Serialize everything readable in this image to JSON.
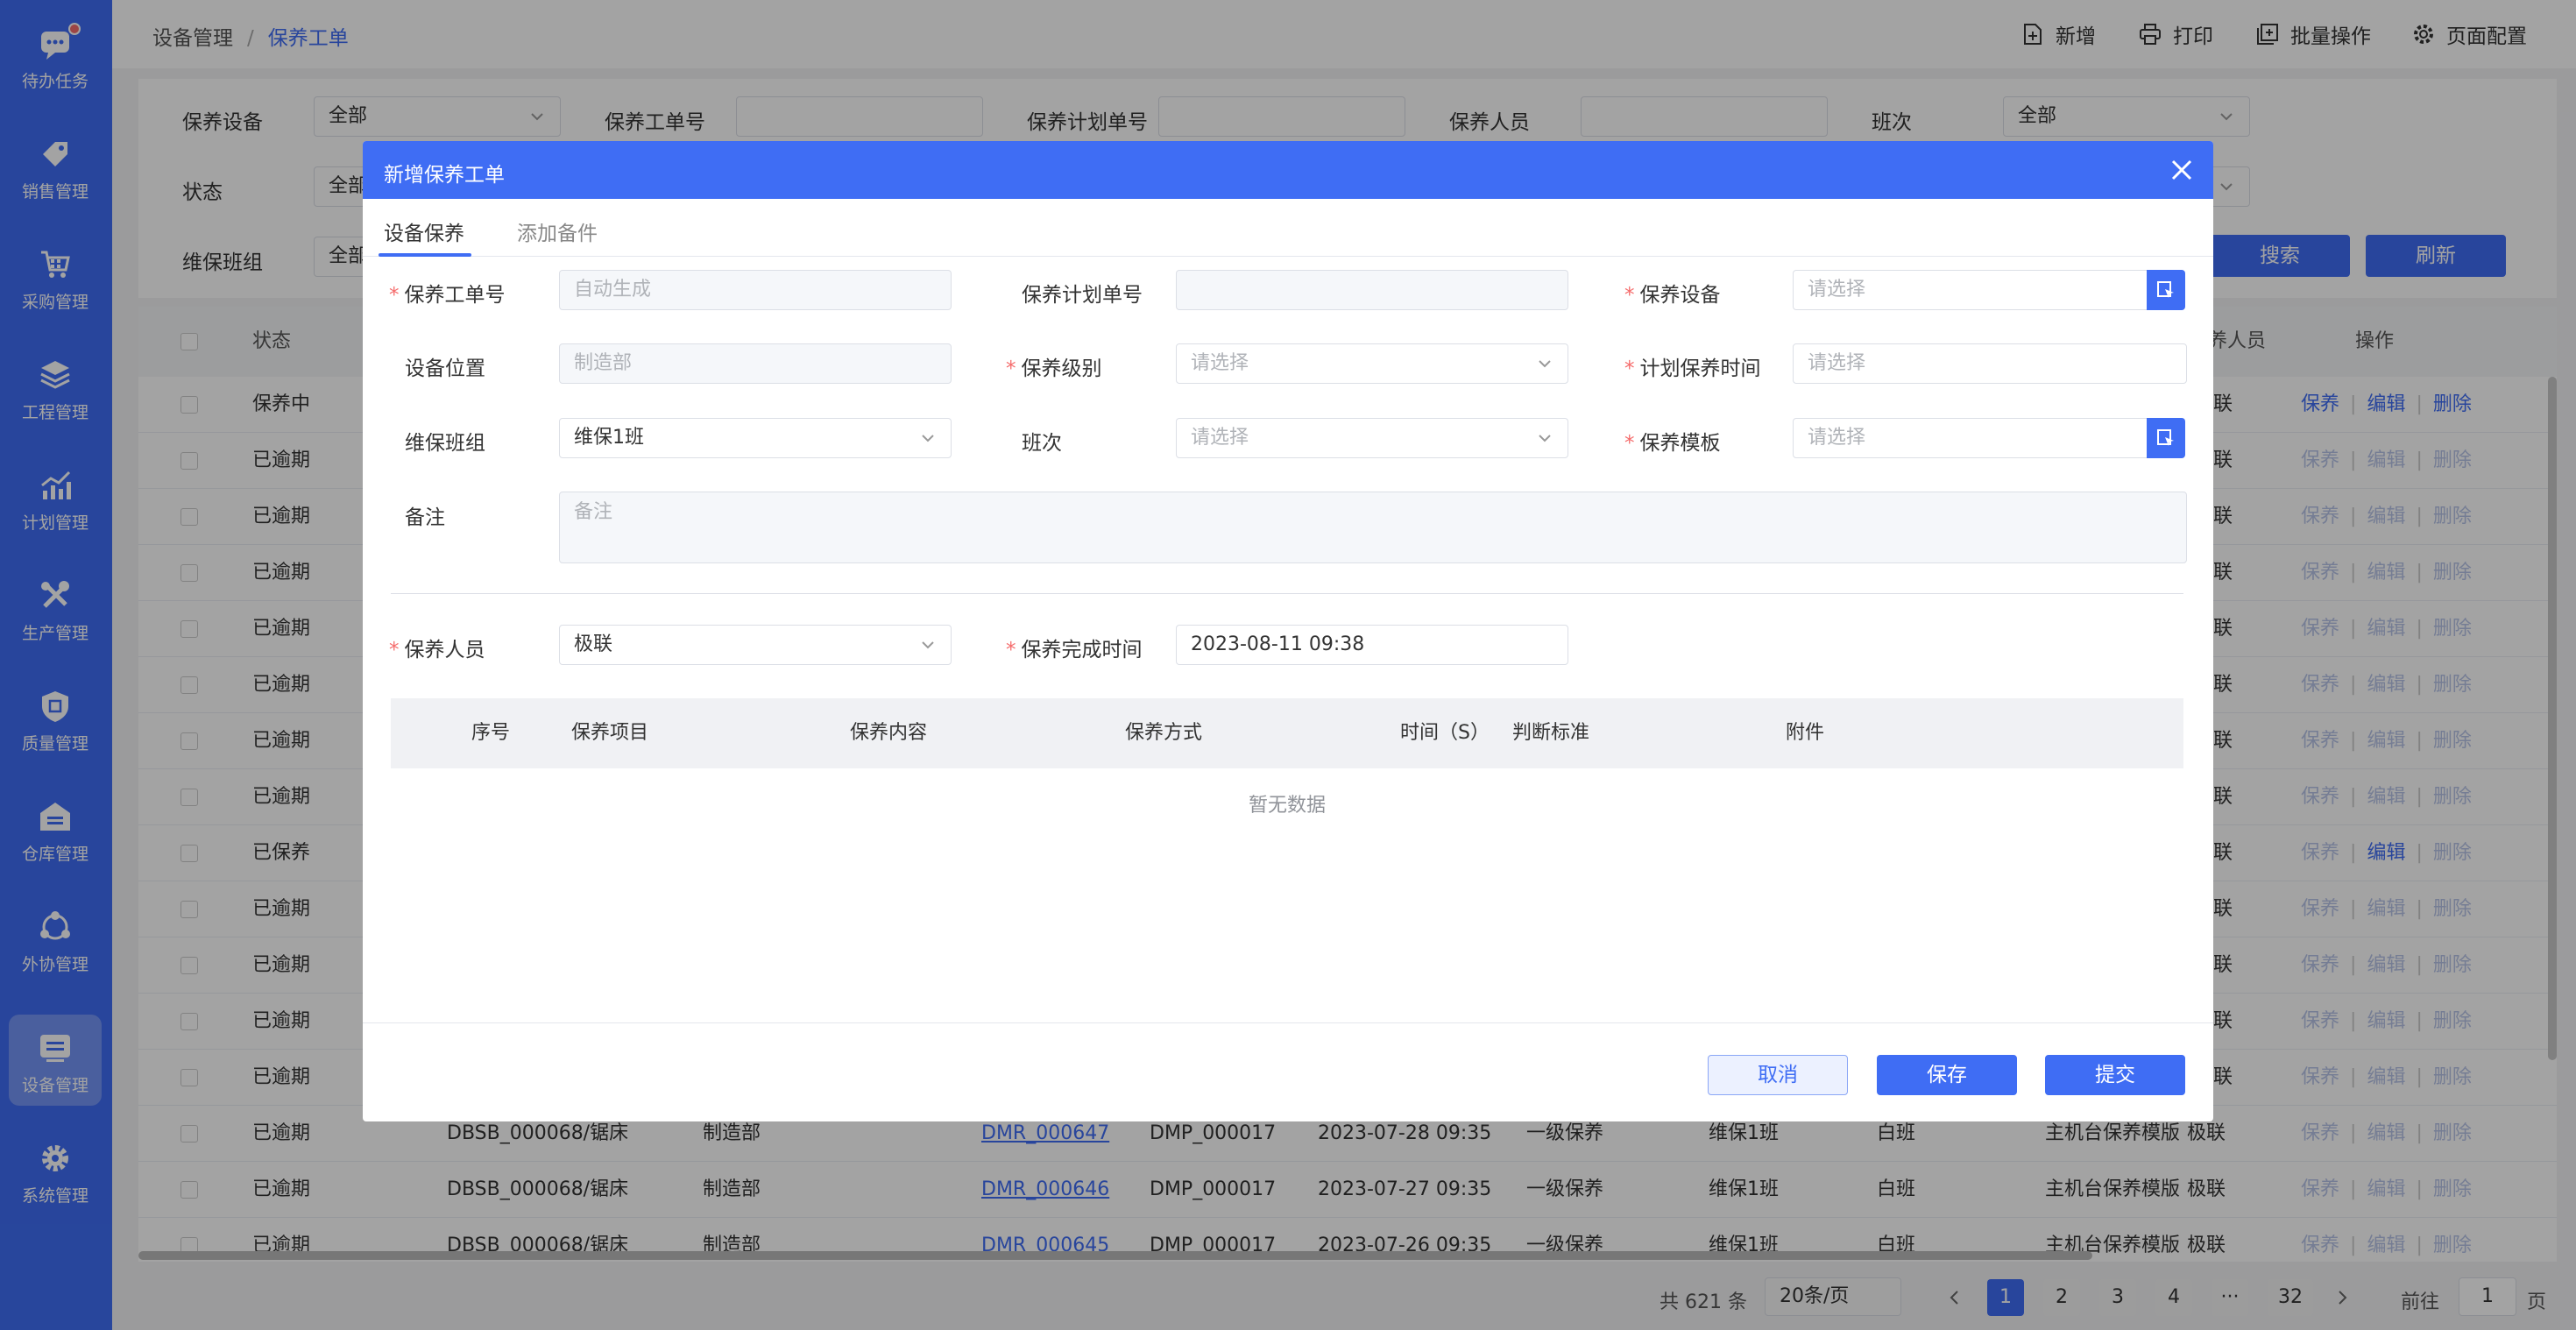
{
  "sidebar": {
    "items": [
      {
        "label": "待办任务",
        "icon": "chat-icon"
      },
      {
        "label": "销售管理",
        "icon": "tag-icon"
      },
      {
        "label": "采购管理",
        "icon": "cart-icon"
      },
      {
        "label": "工程管理",
        "icon": "layers-icon"
      },
      {
        "label": "计划管理",
        "icon": "chart-icon"
      },
      {
        "label": "生产管理",
        "icon": "tools-icon"
      },
      {
        "label": "质量管理",
        "icon": "shield-icon"
      },
      {
        "label": "仓库管理",
        "icon": "warehouse-icon"
      },
      {
        "label": "外协管理",
        "icon": "network-icon"
      },
      {
        "label": "设备管理",
        "icon": "device-icon"
      },
      {
        "label": "系统管理",
        "icon": "gear-icon"
      }
    ]
  },
  "breadcrumb": {
    "parent": "设备管理",
    "sep": "/",
    "current": "保养工单"
  },
  "toolbar": {
    "new": "新增",
    "print": "打印",
    "batch": "批量操作",
    "page_config": "页面配置"
  },
  "filters": {
    "device_label": "保养设备",
    "device_value": "全部",
    "order_label": "保养工单号",
    "plan_label": "保养计划单号",
    "person_label": "保养人员",
    "shift_label": "班次",
    "shift_value": "全部",
    "status_label": "状态",
    "status_value": "全部",
    "team_label": "维保班组",
    "team_value": "全部",
    "search": "搜索",
    "refresh": "刷新"
  },
  "table": {
    "status_header": "状态",
    "person_header": "保养人员",
    "ops_header": "操作",
    "op_maint": "保养",
    "op_edit": "编辑",
    "op_delete": "删除",
    "rows": [
      {
        "status": "保养中"
      },
      {
        "status": "已逾期"
      },
      {
        "status": "已逾期"
      },
      {
        "status": "已逾期"
      },
      {
        "status": "已逾期"
      },
      {
        "status": "已逾期"
      },
      {
        "status": "已逾期"
      },
      {
        "status": "已逾期"
      },
      {
        "status": "已保养"
      },
      {
        "status": "已逾期"
      },
      {
        "status": "已逾期"
      },
      {
        "status": "已逾期"
      },
      {
        "status": "已逾期"
      },
      {
        "status": "已逾期",
        "device": "DBSB_000068/锯床",
        "dept": "制造部",
        "order": "DMR_000647",
        "plan": "DMP_000017",
        "time": "2023-07-28 09:35",
        "level": "一级保养",
        "team": "维保1班",
        "shift": "白班",
        "template": "主机台保养模版",
        "person": "极联"
      },
      {
        "status": "已逾期",
        "device": "DBSB_000068/锯床",
        "dept": "制造部",
        "order": "DMR_000646",
        "plan": "DMP_000017",
        "time": "2023-07-27 09:35",
        "level": "一级保养",
        "team": "维保1班",
        "shift": "白班",
        "template": "主机台保养模版",
        "person": "极联"
      },
      {
        "status": "已逾期",
        "device": "DBSB_000068/锯床",
        "dept": "制造部",
        "order": "DMR_000645",
        "plan": "DMP_000017",
        "time": "2023-07-26 09:35",
        "level": "一级保养",
        "team": "维保1班",
        "shift": "白班",
        "template": "主机台保养模版",
        "person": "极联"
      }
    ],
    "person_partial": "联"
  },
  "pager": {
    "total": "共 621 条",
    "size": "20条/页",
    "pages": [
      "1",
      "2",
      "3",
      "4",
      "···",
      "32"
    ],
    "goto": "前往",
    "goto_value": "1",
    "page_unit": "页"
  },
  "dialog": {
    "title": "新增保养工单",
    "tabs": [
      "设备保养",
      "添加备件"
    ],
    "f_order_label": "保养工单号",
    "f_order_value": "自动生成",
    "f_plan_label": "保养计划单号",
    "f_device_label": "保养设备",
    "f_device_ph": "请选择",
    "f_loc_label": "设备位置",
    "f_loc_value": "制造部",
    "f_level_label": "保养级别",
    "f_level_ph": "请选择",
    "f_ptime_label": "计划保养时间",
    "f_ptime_ph": "请选择",
    "f_team_label": "维保班组",
    "f_team_value": "维保1班",
    "f_shift_label": "班次",
    "f_shift_ph": "请选择",
    "f_tpl_label": "保养模板",
    "f_tpl_ph": "请选择",
    "f_remark_label": "备注",
    "f_remark_ph": "备注",
    "f_person_label": "保养人员",
    "f_person_value": "极联",
    "f_done_label": "保养完成时间",
    "f_done_value": "2023-08-11 09:38",
    "cols": [
      "序号",
      "保养项目",
      "保养内容",
      "保养方式",
      "时间（S）",
      "判断标准",
      "附件"
    ],
    "empty": "暂无数据",
    "cancel": "取消",
    "save": "保存",
    "submit": "提交"
  },
  "colors": {
    "primary": "#3f6df4",
    "required": "#f56c6c"
  }
}
